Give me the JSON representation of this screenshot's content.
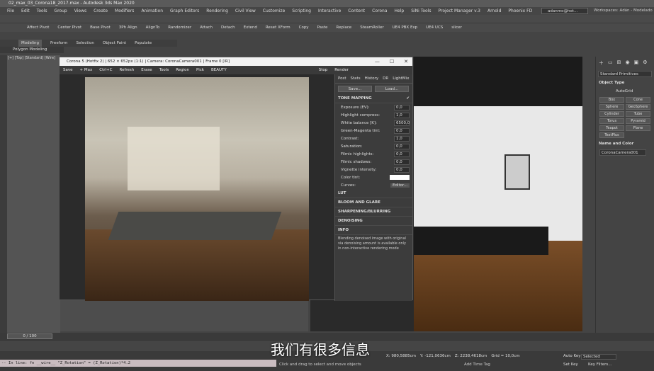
{
  "window": {
    "title": "02_max_03_Corona18_2017.max - Autodesk 3ds Max 2020"
  },
  "menu": [
    "File",
    "Edit",
    "Tools",
    "Group",
    "Views",
    "Create",
    "Modifiers",
    "Animation",
    "Graph Editors",
    "Rendering",
    "Civil View",
    "Customize",
    "Scripting",
    "Interactive",
    "Content",
    "Corona",
    "Help",
    "SiNi Tools",
    "Project Manager v.3",
    "Arnold",
    "Phoenix FD"
  ],
  "user": {
    "name": "adanmo@hot...",
    "workspace_label": "Workspaces: Adán - Modelado"
  },
  "toolbar2": [
    "Affect Pivot",
    "Center Pivot",
    "Base Pivot",
    "3Ph Align",
    "AlignTo",
    "Randomizer",
    "Attach",
    "Detach",
    "Extend",
    "Reset XForm",
    "Copy",
    "Paste",
    "Replace",
    "SteamRoller",
    "UE4 PBX Exp",
    "UE4 UCS",
    "slicer"
  ],
  "ribbon": {
    "tabs": [
      "Modeling",
      "Freeform",
      "Selection",
      "Object Paint",
      "Populate"
    ],
    "sub": "Polygon Modeling"
  },
  "left_viewport": {
    "label": "[+] [Top] [Standard] [Wire]"
  },
  "vfb": {
    "title": "Corona 5 (Hotfix 2) | 652 × 652px (1:1) | Camera: CoronaCamera001 | Frame 0 [IR]",
    "toolbar": [
      "Save",
      "+ Max",
      "Ctrl+C",
      "Refresh",
      "Erase",
      "Tools",
      "Region",
      "Pick"
    ],
    "channel": "BEAUTY",
    "stop": "Stop",
    "render_btn": "Render",
    "tabs": [
      "Post",
      "Stats",
      "History",
      "DR",
      "LightMix"
    ],
    "save_btn": "Save...",
    "load_btn": "Load...",
    "tone_mapping": "TONE MAPPING",
    "params": [
      {
        "label": "Exposure (EV):",
        "value": "0,0"
      },
      {
        "label": "Highlight compress:",
        "value": "1,0"
      },
      {
        "label": "White balance [K]:",
        "value": "6500,0"
      },
      {
        "label": "Green-Magenta tint:",
        "value": "0,0"
      },
      {
        "label": "Contrast:",
        "value": "1,0"
      },
      {
        "label": "Saturation:",
        "value": "0,0"
      },
      {
        "label": "Filmic highlights:",
        "value": "0,0"
      },
      {
        "label": "Filmic shadows:",
        "value": "0,0"
      },
      {
        "label": "Vignette intensity:",
        "value": "0,0"
      }
    ],
    "color_tint": "Color tint:",
    "curves": "Curves:",
    "editor": "Editor...",
    "sections": [
      "LUT",
      "BLOOM AND GLARE",
      "SHARPENING/BLURRING",
      "DENOISING"
    ],
    "info_title": "INFO",
    "info_text": "Blending denoised image with original via denoising amount is available only in non-interactive rendering mode"
  },
  "command_panel": {
    "category": "Standard Primitives",
    "object_type": "Object Type",
    "autogrid": "AutoGrid",
    "buttons": [
      "Box",
      "Cone",
      "Sphere",
      "GeoSphere",
      "Cylinder",
      "Tube",
      "Torus",
      "Pyramid",
      "Teapot",
      "Plane",
      "TextPlus"
    ],
    "name_color": "Name and Color",
    "camera_name": "CoronaCamera001"
  },
  "timeline": {
    "frame": "0 / 100"
  },
  "status": {
    "script": "-- In line: fn __wire__ \"Z_Rotation\" = (Z_Rotation)*4.2",
    "hint": "Click and drag to select and move objects",
    "x": "X: 980,5885cm",
    "y": "Y: -121,0636cm",
    "z": "Z: 2238,4618cm",
    "grid": "Grid = 10,0cm",
    "add_time_tag": "Add Time Tag",
    "auto_key": "Auto Key",
    "selected": "Selected",
    "set_key": "Set Key",
    "key_filters": "Key Filters..."
  },
  "subtitle": "我们有很多信息"
}
